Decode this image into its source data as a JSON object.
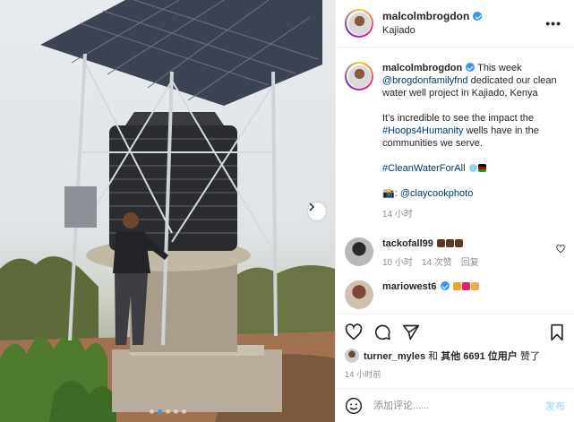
{
  "post": {
    "username": "malcolmbrogdon",
    "location": "Kajiado",
    "more_label": "•••",
    "image_slides": 5,
    "active_slide": 1
  },
  "caption": {
    "username": "malcolmbrogdon",
    "mention": "@brogdonfamilyfnd",
    "text_before": "This week",
    "text_after": "dedicated our clean water well project in Kajiado, Kenya",
    "para2_before": "It's incredible to see the impact the",
    "hashtag1": "#Hoops4Humanity",
    "para2_after": "wells have in the communities we serve.",
    "hashtag2": "#CleanWaterForAll",
    "photo_prefix": "📸:",
    "photo_credit": "@claycookphoto",
    "time": "14 小时"
  },
  "comments": [
    {
      "username": "tackofall99",
      "time": "10 小时",
      "likes": "14 次赞",
      "reply": "回复"
    },
    {
      "username": "mariowest6"
    }
  ],
  "actions": {
    "liked_by_user": "turner_myles",
    "liked_connector": "和",
    "liked_others": "其他 6691 位用户",
    "liked_suffix": "赞了",
    "time": "14 小时前"
  },
  "comment_box": {
    "placeholder": "添加评论......",
    "post_label": "发布"
  },
  "colors": {
    "verified": "#3897f0",
    "link": "#00376b",
    "post_disabled": "#b2dffc",
    "muted": "#8e8e8e"
  }
}
